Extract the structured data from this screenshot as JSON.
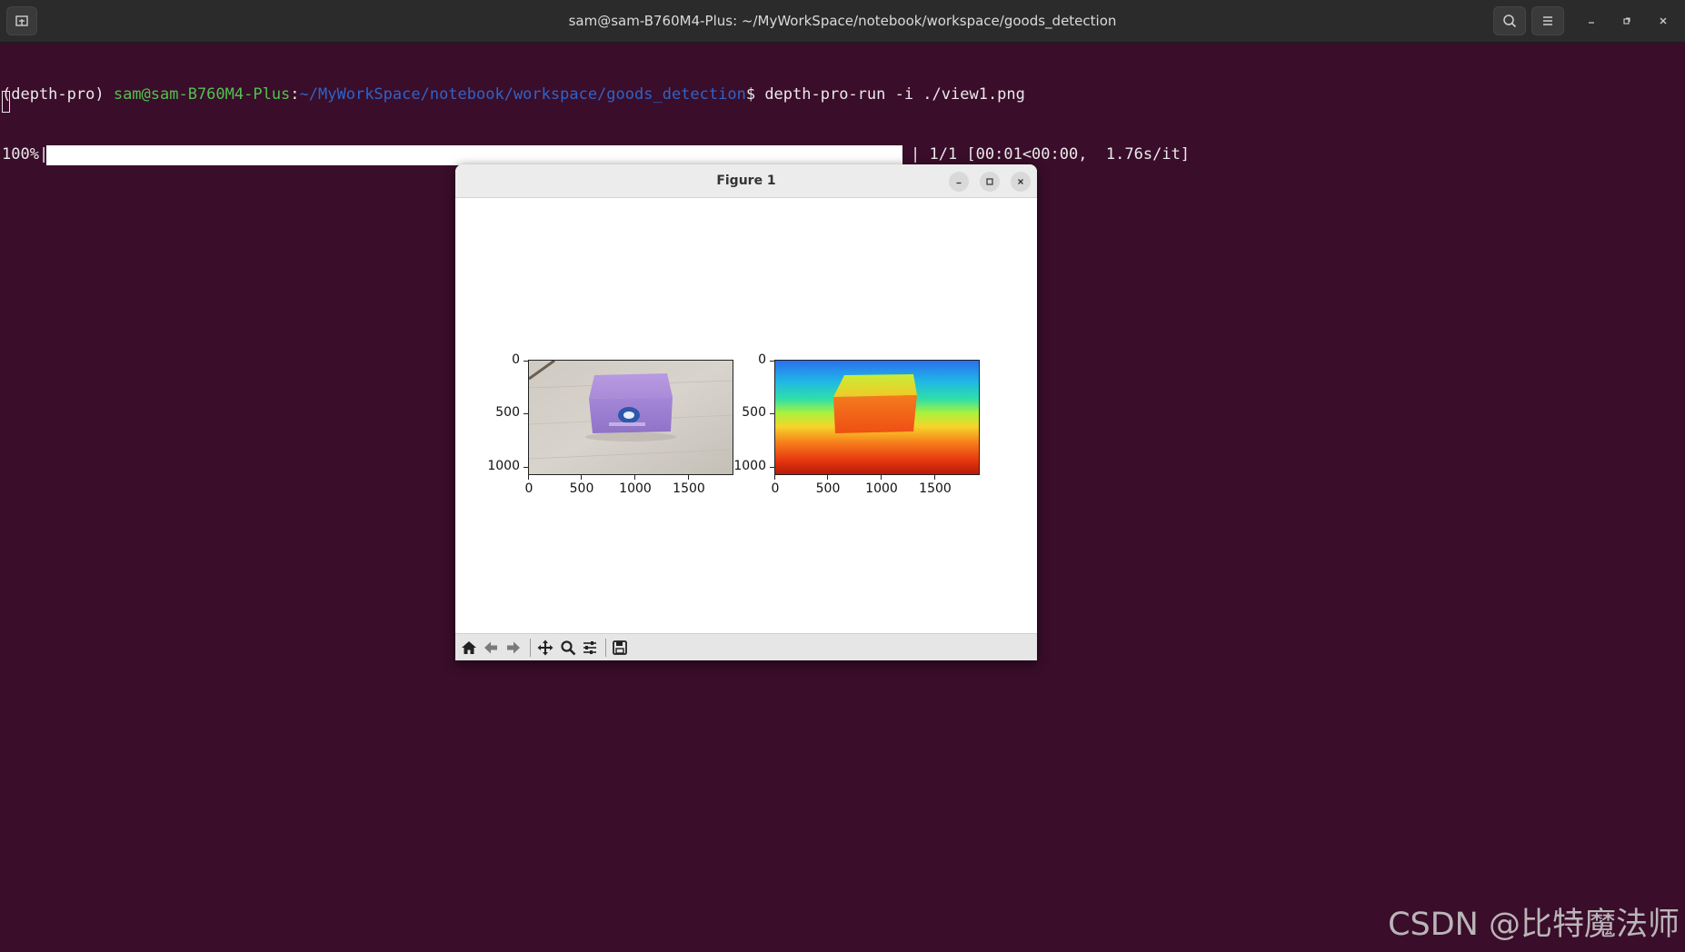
{
  "window": {
    "title": "sam@sam-B760M4-Plus: ~/MyWorkSpace/notebook/workspace/goods_detection"
  },
  "terminal": {
    "prompt_env": "(depth-pro) ",
    "prompt_user": "sam@sam-B760M4-Plus",
    "prompt_colon": ":",
    "prompt_path": "~/MyWorkSpace/notebook/workspace/goods_detection",
    "prompt_symbol": "$ ",
    "command": "depth-pro-run -i ./view1.png",
    "progress_percent_text": "100%|",
    "progress_fraction": 1.0,
    "progress_suffix": "| 1/1 [00:01<00:00,  1.76s/it]"
  },
  "figure": {
    "title": "Figure 1",
    "left_axes": {
      "y_ticks": [
        "0",
        "500",
        "1000"
      ],
      "x_ticks": [
        "0",
        "500",
        "1000",
        "1500"
      ],
      "image": "rgb photo of purple tissue box on wooden floor"
    },
    "right_axes": {
      "y_ticks": [
        "0",
        "500",
        "1000"
      ],
      "x_ticks": [
        "0",
        "500",
        "1000",
        "1500"
      ],
      "image": "depth map, jet/turbo colormap"
    }
  },
  "toolbar": {
    "icons": [
      "home-icon",
      "back-arrow-icon",
      "forward-arrow-icon",
      "pan-move-icon",
      "zoom-magnifier-icon",
      "configure-sliders-icon",
      "save-disk-icon"
    ]
  },
  "watermark": "CSDN @比特魔法师"
}
